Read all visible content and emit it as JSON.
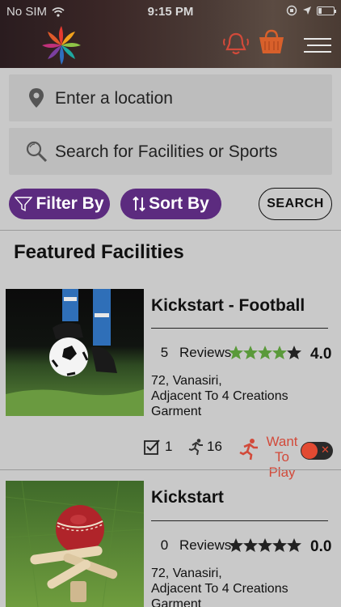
{
  "status": {
    "carrier": "No SIM",
    "time": "9:15 PM"
  },
  "search": {
    "location_placeholder": "Enter a location",
    "query_placeholder": "Search for Facilities or Sports",
    "button": "SEARCH"
  },
  "controls": {
    "filter_label": "Filter By",
    "sort_label": "Sort By"
  },
  "section": {
    "title": "Featured Facilities"
  },
  "cards": [
    {
      "title": "Kickstart - Football",
      "reviews_count": "5",
      "reviews_label": "Reviews",
      "stars_filled": 4,
      "rating": "4.0",
      "address_line1": "72, Vanasiri,",
      "address_line2": "Adjacent To 4 Creations Garment",
      "checkins": "1",
      "players": "16",
      "want_to_play": "Want To Play",
      "sport": "football"
    },
    {
      "title": "Kickstart",
      "reviews_count": "0",
      "reviews_label": "Reviews",
      "stars_filled": 0,
      "rating": "0.0",
      "address_line1": "72, Vanasiri,",
      "address_line2": "Adjacent To 4 Creations Garment",
      "sport": "cricket"
    }
  ],
  "colors": {
    "accent": "#5c2b7f",
    "star_filled": "#5a9a3a",
    "star_empty": "#222222",
    "alert": "#d24a3a"
  },
  "icons": [
    "logo-icon",
    "bell-icon",
    "bag-icon",
    "menu-icon",
    "location-pin-icon",
    "search-icon",
    "filter-icon",
    "sort-icon",
    "checkbox-icon",
    "runner-icon",
    "want-to-play-icon"
  ]
}
